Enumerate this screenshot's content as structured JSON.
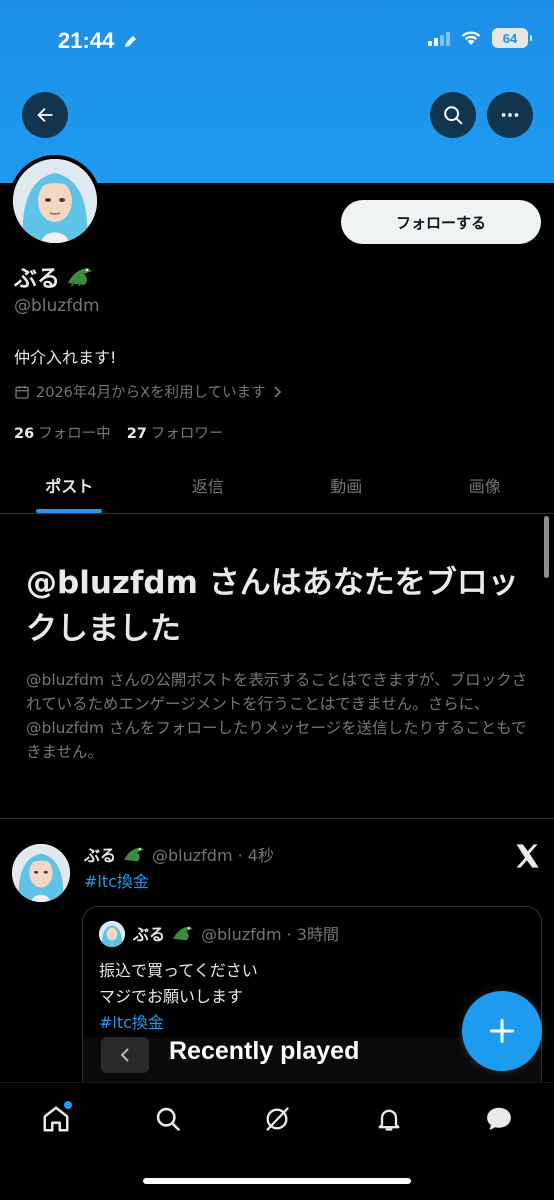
{
  "status_bar": {
    "time": "21:44",
    "battery": "64"
  },
  "profile": {
    "display_name": "ぶる",
    "handle": "@bluzfdm",
    "bio": "仲介入れます!",
    "joined": "2026年4月からXを利用しています",
    "following_count": "26",
    "following_label": "フォロー中",
    "followers_count": "27",
    "followers_label": "フォロワー",
    "follow_button": "フォローする"
  },
  "tabs": [
    {
      "label": "ポスト",
      "active": true
    },
    {
      "label": "返信",
      "active": false
    },
    {
      "label": "動画",
      "active": false
    },
    {
      "label": "画像",
      "active": false
    }
  ],
  "blocked": {
    "title": "@bluzfdm さんはあなたをブロックしました",
    "description": "@bluzfdm さんの公開ポストを表示することはできますが、ブロックされているためエンゲージメントを行うことはできません。さらに、@bluzfdm さんをフォローしたりメッセージを送信したりすることもできません。"
  },
  "tweet": {
    "name": "ぶる",
    "handle_time": "@bluzfdm · 4秒",
    "text": "#ltc換金",
    "quote": {
      "name": "ぶる",
      "handle_time": "@bluzfdm · 3時間",
      "line1": "振込で買ってください",
      "line2": "マジでお願いします",
      "hashtag": "#ltc換金",
      "media_title": "Recently played"
    }
  },
  "colors": {
    "accent": "#1d9bf0",
    "banner": "#1d9bf0",
    "background": "#000000",
    "muted": "#71767b"
  },
  "icons": {
    "header": [
      "back-arrow-icon",
      "search-icon",
      "more-icon"
    ],
    "nav": [
      "home-icon",
      "search-icon",
      "grok-icon",
      "notifications-icon",
      "messages-icon"
    ]
  }
}
